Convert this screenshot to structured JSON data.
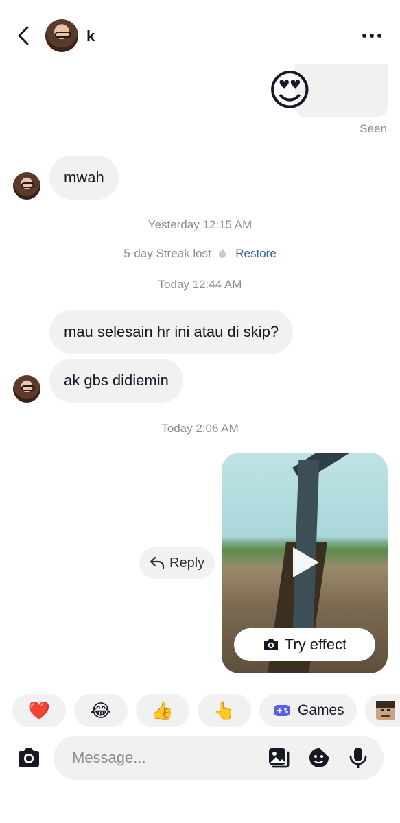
{
  "header": {
    "contact_name": "k",
    "icons": {
      "back": "chevron-left-icon",
      "more": "more-horizontal-icon"
    }
  },
  "messages": {
    "sent_sticker": {
      "emoji": "😍",
      "status": "Seen"
    },
    "received_1": "mwah",
    "timestamp_1": "Yesterday 12:15 AM",
    "streak": {
      "text": "5-day Streak lost",
      "action": "Restore"
    },
    "timestamp_2": "Today 12:44 AM",
    "received_2": "mau selesain hr ini atau di skip?",
    "received_3": "ak gbs didiemin",
    "timestamp_3": "Today 2:06 AM",
    "reply_label": "Reply",
    "video": {
      "action_label": "Try effect"
    }
  },
  "quick_reactions": [
    {
      "label": "❤️"
    },
    {
      "label": "😂"
    },
    {
      "label": "👍"
    },
    {
      "label": "👆"
    },
    {
      "label": "Games"
    }
  ],
  "composer": {
    "placeholder": "Message...",
    "icons": [
      "camera-icon",
      "image-sticker-icon",
      "sticker-icon",
      "microphone-icon"
    ]
  },
  "colors": {
    "link": "#2a5fb0",
    "bubble": "#f1f1f2",
    "muted": "#8a8b91",
    "text": "#161823"
  }
}
